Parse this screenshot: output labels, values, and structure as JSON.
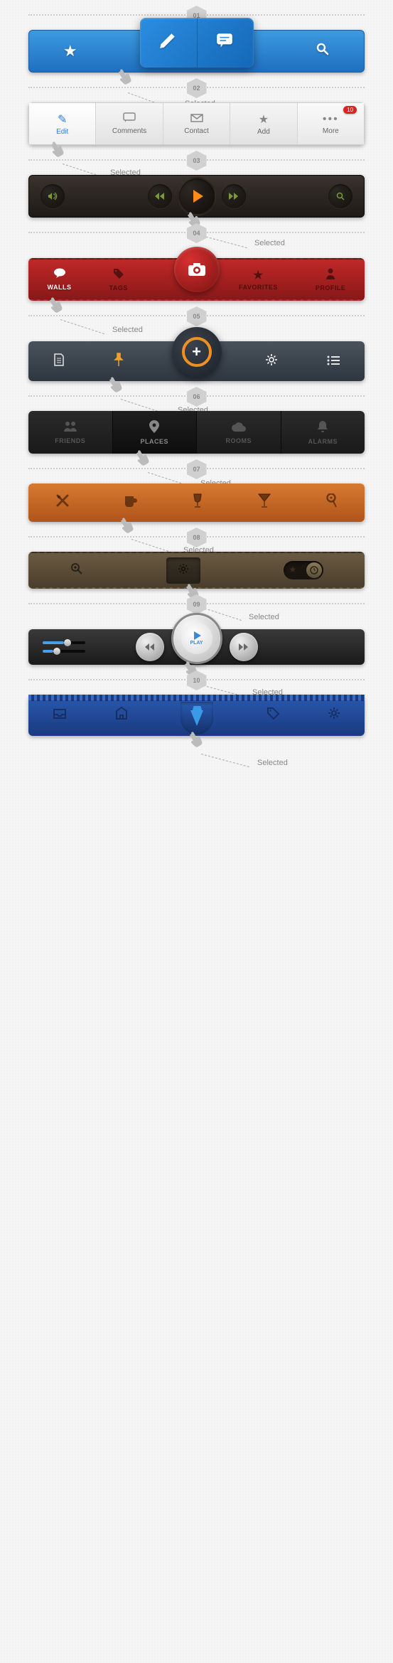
{
  "selected_label": "Selected",
  "sections": {
    "s1": {
      "num": "01"
    },
    "s2": {
      "num": "02"
    },
    "s3": {
      "num": "03"
    },
    "s4": {
      "num": "04"
    },
    "s5": {
      "num": "05"
    },
    "s6": {
      "num": "06"
    },
    "s7": {
      "num": "07"
    },
    "s8": {
      "num": "08"
    },
    "s9": {
      "num": "09"
    },
    "s10": {
      "num": "10"
    }
  },
  "bar1": {
    "icons": {
      "star": "★",
      "pencil": "✎",
      "chat": "▤",
      "search": "🔍"
    }
  },
  "bar2": {
    "tabs": {
      "edit": "Edit",
      "comments": "Comments",
      "contact": "Contact",
      "add": "Add",
      "more": "More"
    },
    "badge": "10"
  },
  "bar4": {
    "tabs": {
      "walls": "WALLS",
      "tags": "TAGS",
      "favorites": "FAVORITES",
      "profile": "PROFILE"
    }
  },
  "bar6": {
    "tabs": {
      "friends": "FRIENDS",
      "places": "PLACES",
      "rooms": "ROOMS",
      "alarms": "ALARMS"
    }
  },
  "bar9": {
    "play_label": "PLAY",
    "slider1_pct": 50,
    "slider2_pct": 25
  }
}
